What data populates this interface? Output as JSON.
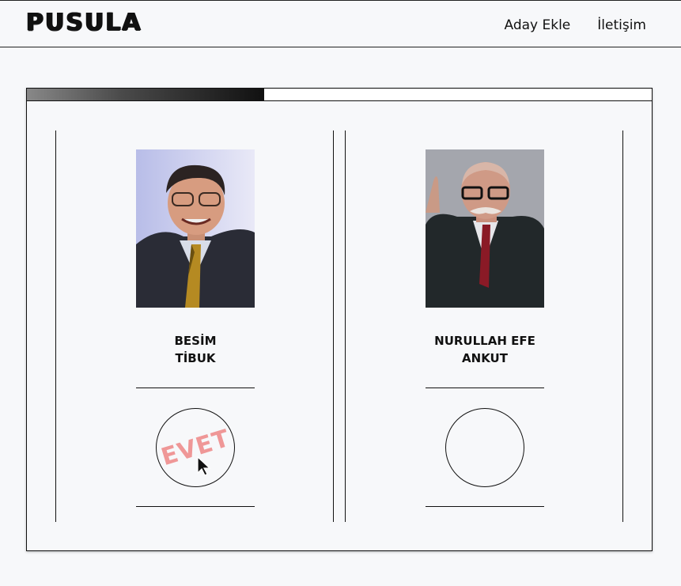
{
  "header": {
    "logo": "PUSULA",
    "nav": [
      "Aday Ekle",
      "İletişim"
    ]
  },
  "ballot": {
    "progress_fraction": 0.38,
    "candidates": [
      {
        "name": "BESİM\nTİBUK",
        "vote_mark": "EVET",
        "selected": true
      },
      {
        "name": "NURULLAH EFE\nANKUT",
        "vote_mark": "",
        "selected": false
      }
    ]
  },
  "colors": {
    "stamp": "#ee8c8c",
    "background": "#f7f8fa",
    "line": "#111111"
  }
}
